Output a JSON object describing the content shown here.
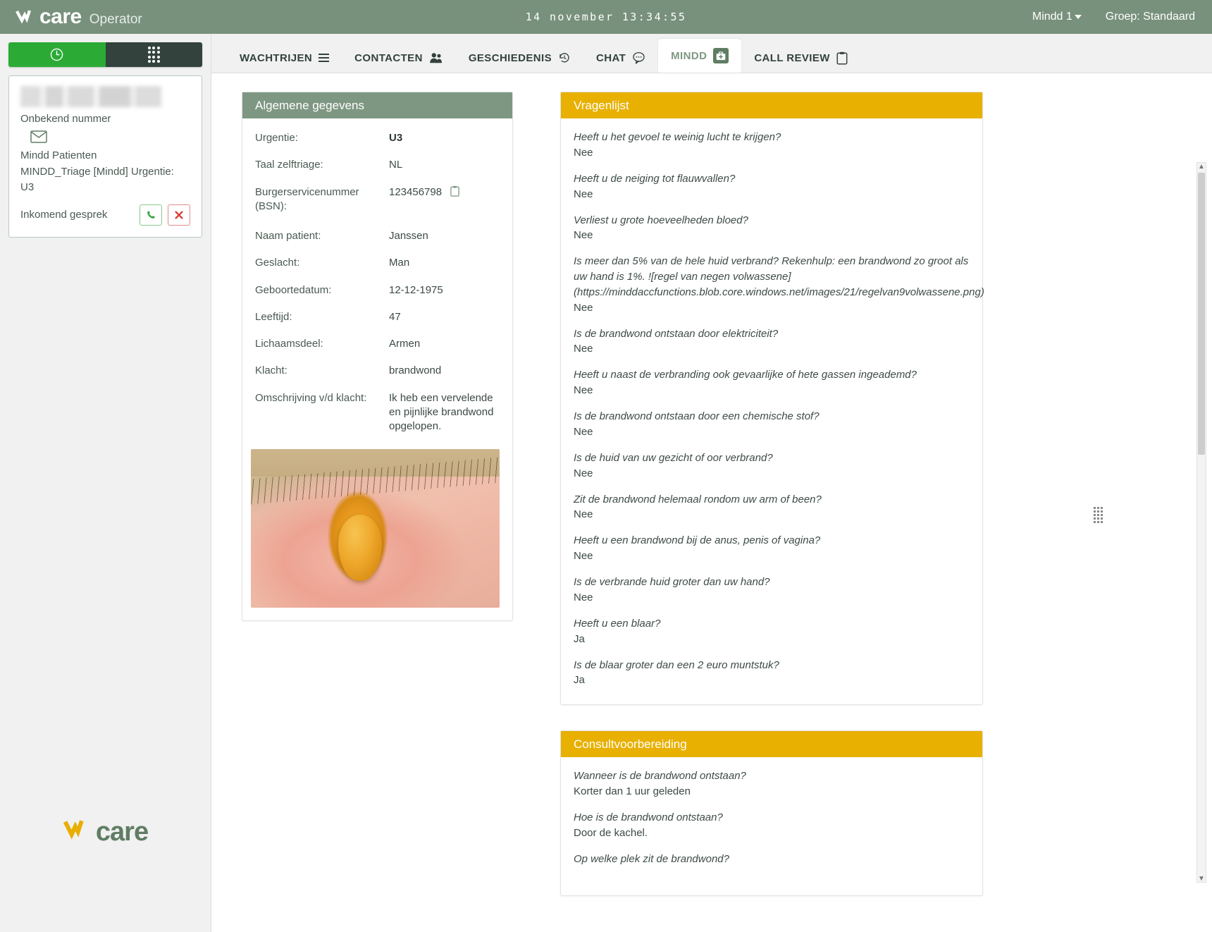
{
  "header": {
    "brand_mark": "care",
    "brand_prefix": "N",
    "app_name": "Operator",
    "clock": "14 november 13:34:55",
    "user": "Mindd 1",
    "group": "Groep: Standaard"
  },
  "sidebar": {
    "toggle": {
      "clock_icon": "clock-icon",
      "dialpad_icon": "dialpad-icon"
    },
    "call_card": {
      "caller_name_redacted": "",
      "number_label": "Onbekend nummer",
      "mail_icon": "envelope-icon",
      "queue": "Mindd Patienten",
      "triage": "MINDD_Triage [Mindd] Urgentie: U3",
      "status": "Inkomend gesprek",
      "accept_icon": "phone-icon",
      "reject_icon": "close-icon"
    },
    "logo_v": "N",
    "logo_text": "care"
  },
  "tabs": [
    {
      "label": "WACHTRIJEN",
      "icon": "hamburger-icon",
      "active": false
    },
    {
      "label": "CONTACTEN",
      "icon": "users-icon",
      "active": false
    },
    {
      "label": "GESCHIEDENIS",
      "icon": "history-icon",
      "active": false
    },
    {
      "label": "CHAT",
      "icon": "chat-bubble-icon",
      "active": false
    },
    {
      "label": "MINDD",
      "icon": "medkit-icon",
      "active": true
    },
    {
      "label": "CALL REVIEW",
      "icon": "clipboard-icon",
      "active": false
    }
  ],
  "general_panel": {
    "title": "Algemene gegevens",
    "fields": [
      {
        "key": "Urgentie:",
        "value": "U3",
        "bold": true
      },
      {
        "key": "Taal zelftriage:",
        "value": "NL",
        "bold": false
      },
      {
        "key": "Burgerservicenummer (BSN):",
        "value": "123456798",
        "bold": false,
        "copy": true
      },
      {
        "key": "Naam patient:",
        "value": "Janssen",
        "bold": false
      },
      {
        "key": "Geslacht:",
        "value": "Man",
        "bold": false
      },
      {
        "key": "Geboortedatum:",
        "value": "12-12-1975",
        "bold": false
      },
      {
        "key": "Leeftijd:",
        "value": "47",
        "bold": false
      },
      {
        "key": "Lichaamsdeel:",
        "value": "Armen",
        "bold": false
      },
      {
        "key": "Klacht:",
        "value": "brandwond",
        "bold": false
      },
      {
        "key": "Omschrijving v/d klacht:",
        "value": "Ik heb een vervelende en pijnlijke brandwond opgelopen.",
        "bold": false
      }
    ],
    "photo_alt": "brandwond-foto"
  },
  "questionnaire_panel": {
    "title": "Vragenlijst",
    "items": [
      {
        "q": "Heeft u het gevoel te weinig lucht te krijgen?",
        "a": "Nee"
      },
      {
        "q": "Heeft u de neiging tot flauwvallen?",
        "a": "Nee"
      },
      {
        "q": "Verliest u grote hoeveelheden bloed?",
        "a": "Nee"
      },
      {
        "q": "Is meer dan 5% van de hele huid verbrand? Rekenhulp: een brandwond zo groot als uw hand is 1%.  ![regel van negen volwassene] (https://minddaccfunctions.blob.core.windows.net/images/21/regelvan9volwassene.png)",
        "a": "Nee"
      },
      {
        "q": "Is de brandwond ontstaan door elektriciteit?",
        "a": "Nee"
      },
      {
        "q": "Heeft u naast de verbranding ook gevaarlijke of hete gassen ingeademd?",
        "a": "Nee"
      },
      {
        "q": "Is de brandwond ontstaan door een chemische stof?",
        "a": "Nee"
      },
      {
        "q": "Is de huid van uw gezicht of oor verbrand?",
        "a": "Nee"
      },
      {
        "q": "Zit de brandwond helemaal rondom uw arm of been?",
        "a": "Nee"
      },
      {
        "q": "Heeft u een brandwond bij de anus, penis of vagina?",
        "a": "Nee"
      },
      {
        "q": "Is de verbrande huid groter dan uw hand?",
        "a": "Nee"
      },
      {
        "q": "Heeft u een blaar?",
        "a": "Ja"
      },
      {
        "q": "Is de blaar groter dan een 2 euro muntstuk?",
        "a": "Ja"
      }
    ]
  },
  "consult_panel": {
    "title": "Consultvoorbereiding",
    "items": [
      {
        "q": "Wanneer is de brandwond ontstaan?",
        "a": "Korter dan 1 uur geleden"
      },
      {
        "q": "Hoe is de brandwond ontstaan?",
        "a": "Door de kachel."
      },
      {
        "q": "Op welke plek zit de brandwond?",
        "a": ""
      }
    ]
  },
  "colors": {
    "header_green": "#78917c",
    "panel_green": "#7e9782",
    "panel_yellow": "#e8b000",
    "accent_green": "#2bab36",
    "logo_yellow": "#e8ae00"
  },
  "scroll": {
    "up_arrow": "▲",
    "down_arrow": "▼",
    "drag_handle": "grip-icon"
  }
}
